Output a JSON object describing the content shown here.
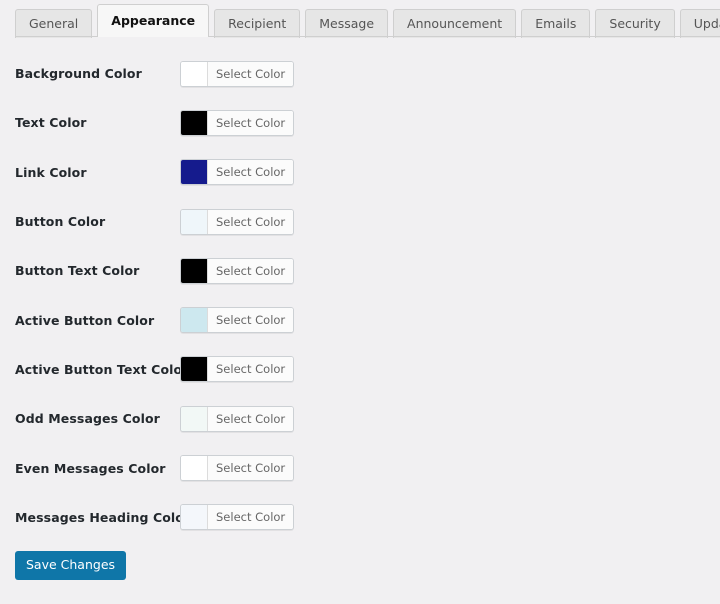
{
  "tabs": [
    {
      "label": "General",
      "active": false
    },
    {
      "label": "Appearance",
      "active": true
    },
    {
      "label": "Recipient",
      "active": false
    },
    {
      "label": "Message",
      "active": false
    },
    {
      "label": "Announcement",
      "active": false
    },
    {
      "label": "Emails",
      "active": false
    },
    {
      "label": "Security",
      "active": false
    },
    {
      "label": "Update",
      "active": false
    }
  ],
  "settings": {
    "select_color_label": "Select Color",
    "rows": [
      {
        "label": "Background Color",
        "color": "#ffffff"
      },
      {
        "label": "Text Color",
        "color": "#000000"
      },
      {
        "label": "Link Color",
        "color": "#151b8d"
      },
      {
        "label": "Button Color",
        "color": "#eff6fa"
      },
      {
        "label": "Button Text Color",
        "color": "#000000"
      },
      {
        "label": "Active Button Color",
        "color": "#cde8ef"
      },
      {
        "label": "Active Button Text Color",
        "color": "#000000"
      },
      {
        "label": "Odd Messages Color",
        "color": "#f2f8f6"
      },
      {
        "label": "Even Messages Color",
        "color": "#ffffff"
      },
      {
        "label": "Messages Heading Color",
        "color": "#f4f7fb"
      }
    ]
  },
  "footer": {
    "save_label": "Save Changes",
    "save_color": "#0f76a8"
  }
}
